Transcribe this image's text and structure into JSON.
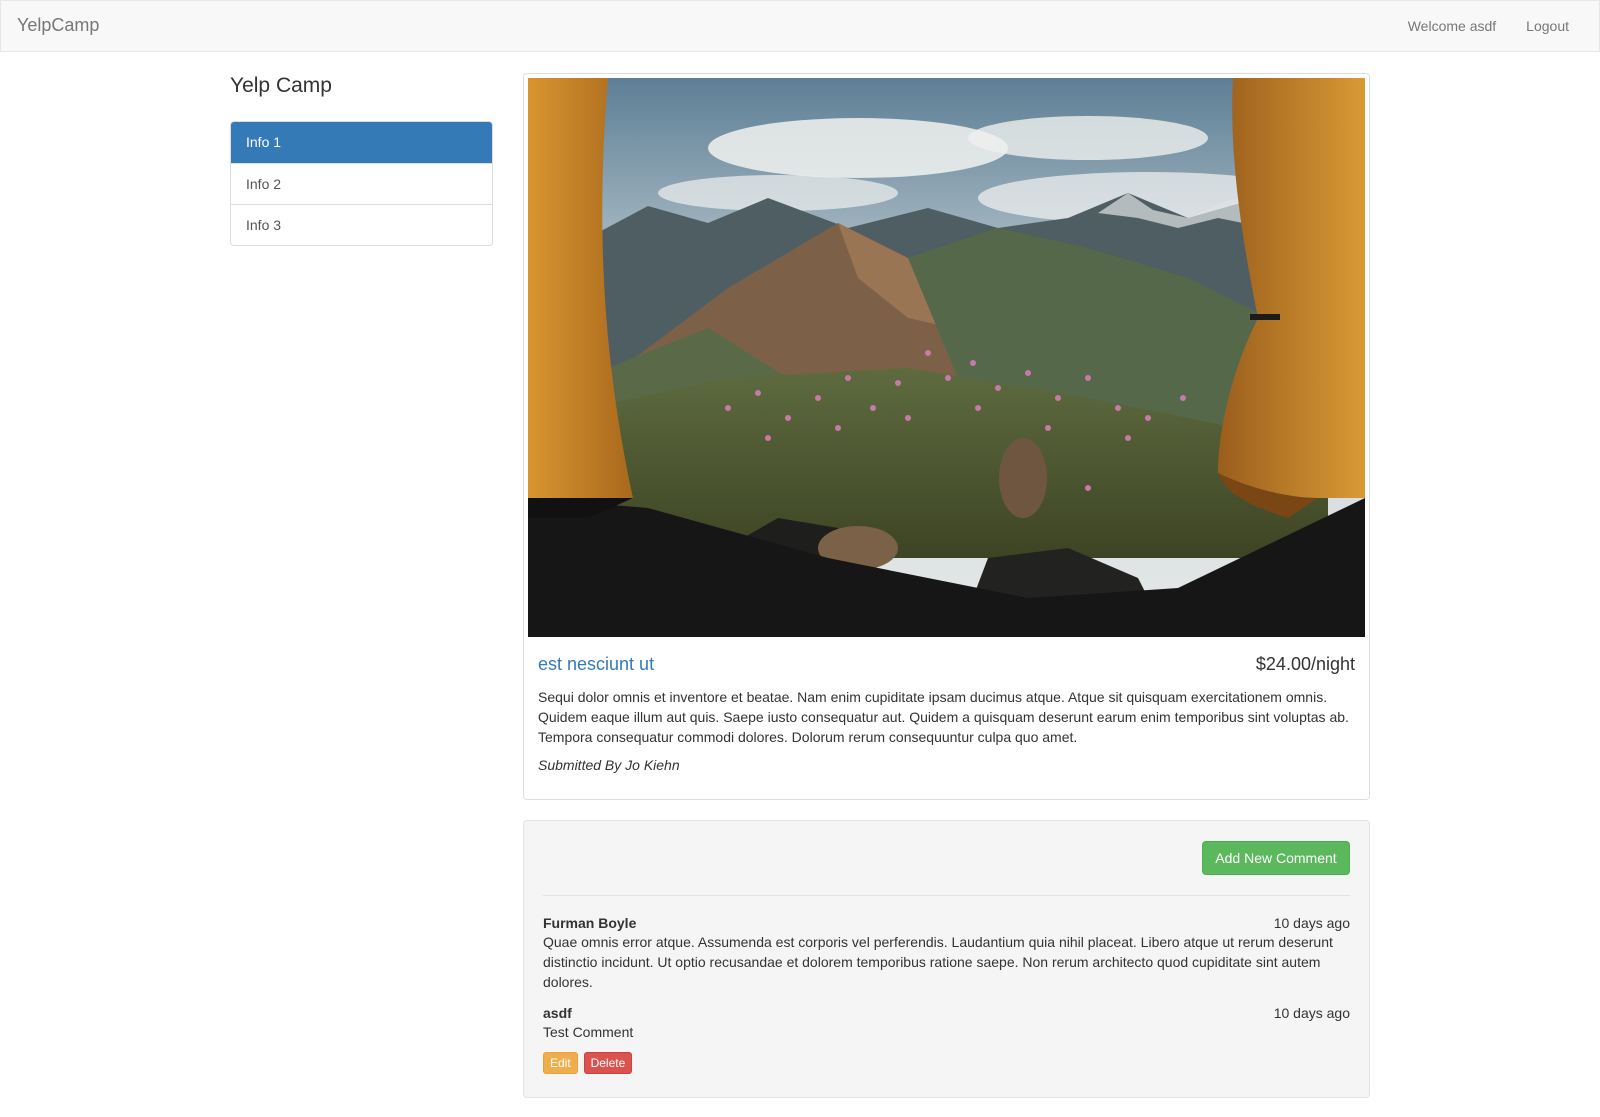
{
  "navbar": {
    "brand": "YelpCamp",
    "welcome": "Welcome asdf",
    "logout": "Logout"
  },
  "sidebar": {
    "title": "Yelp Camp",
    "items": [
      {
        "label": "Info 1",
        "active": true
      },
      {
        "label": "Info 2",
        "active": false
      },
      {
        "label": "Info 3",
        "active": false
      }
    ]
  },
  "campground": {
    "name": "est nesciunt ut",
    "price": "$24.00/night",
    "description": "Sequi dolor omnis et inventore et beatae. Nam enim cupiditate ipsam ducimus atque. Atque sit quisquam exercitationem omnis. Quidem eaque illum aut quis. Saepe iusto consequatur aut. Quidem a quisquam deserunt earum enim temporibus sint voluptas ab. Tempora consequatur commodi dolores. Dolorum rerum consequuntur culpa quo amet.",
    "submitted_by": "Submitted By Jo Kiehn",
    "image_icon": "tent-mountain-view-photo"
  },
  "comments": {
    "add_label": "Add New Comment",
    "items": [
      {
        "author": "Furman Boyle",
        "time": "10 days ago",
        "text": "Quae omnis error atque. Assumenda est corporis vel perferendis. Laudantium quia nihil placeat. Libero atque ut rerum deserunt distinctio incidunt. Ut optio recusandae et dolorem temporibus ratione saepe. Non rerum architecto quod cupiditate sint autem dolores."
      },
      {
        "author": "asdf",
        "time": "10 days ago",
        "text": "Test Comment",
        "edit_label": "Edit",
        "delete_label": "Delete"
      }
    ]
  },
  "colors": {
    "primary": "#337ab7",
    "success": "#5cb85c",
    "warning": "#f0ad4e",
    "danger": "#d9534f"
  }
}
